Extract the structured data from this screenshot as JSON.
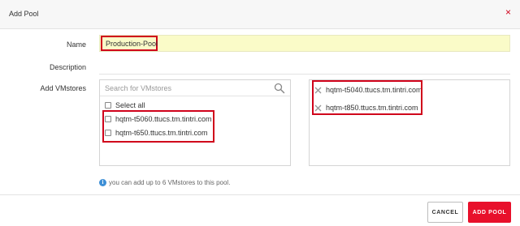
{
  "dialog": {
    "title": "Add Pool",
    "close_glyph": "×"
  },
  "form": {
    "name_label": "Name",
    "name_value": "Production-Pool",
    "description_label": "Description",
    "description_value": "",
    "vmstores_label": "Add VMstores"
  },
  "available": {
    "search_placeholder": "Search for VMstores",
    "select_all_label": "Select all",
    "items": [
      {
        "label": "hqtm-t5060.ttucs.tm.tintri.com",
        "checked": false
      },
      {
        "label": "hqtm-t650.ttucs.tm.tintri.com",
        "checked": false
      }
    ]
  },
  "selected": {
    "items": [
      {
        "label": "hqtm-t5040.ttucs.tm.tintri.com"
      },
      {
        "label": "hqtm-t850.ttucs.tm.tintri.com"
      }
    ]
  },
  "info_text": "you can add up to 6 VMstores to this pool.",
  "buttons": {
    "cancel_label": "CANCEL",
    "add_label": "ADD POOL"
  },
  "colors": {
    "accent": "#e8102b",
    "highlight_border": "#d0021b",
    "name_field_bg": "#fafbc8",
    "info_icon": "#3d8fd6"
  },
  "icons": {
    "close": "close-icon",
    "search": "search-icon",
    "remove": "remove-icon",
    "info": "info-icon"
  }
}
